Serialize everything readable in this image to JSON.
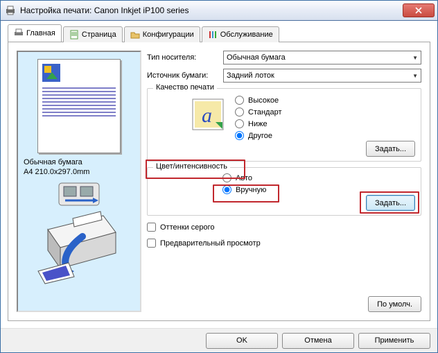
{
  "window": {
    "title": "Настройка печати: Canon Inkjet iP100 series"
  },
  "tabs": {
    "main": "Главная",
    "page": "Страница",
    "config": "Конфигурации",
    "maint": "Обслуживание"
  },
  "preview": {
    "media": "Обычная бумага",
    "size": "A4 210.0x297.0mm"
  },
  "form": {
    "media_label": "Тип носителя:",
    "media_value": "Обычная бумага",
    "source_label": "Источник бумаги:",
    "source_value": "Задний лоток"
  },
  "quality": {
    "label": "Качество печати",
    "high": "Высокое",
    "standard": "Стандарт",
    "low": "Ниже",
    "other": "Другое",
    "set": "Задать..."
  },
  "color": {
    "label": "Цвет/интенсивность",
    "auto": "Авто",
    "manual": "Вручную",
    "set": "Задать..."
  },
  "checks": {
    "grayscale": "Оттенки серого",
    "preview": "Предварительный просмотр"
  },
  "buttons": {
    "defaults": "По умолч.",
    "ok": "OK",
    "cancel": "Отмена",
    "apply": "Применить"
  }
}
